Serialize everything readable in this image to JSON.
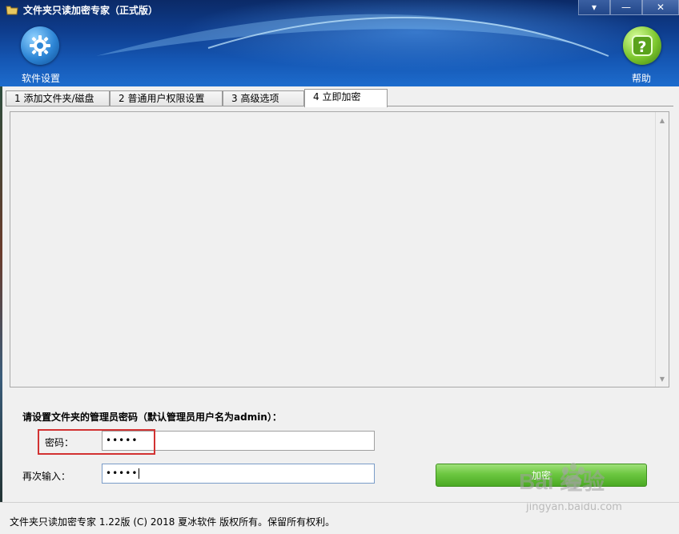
{
  "window": {
    "title": "文件夹只读加密专家（正式版）",
    "controls": {
      "menu": "▾",
      "minimize": "—",
      "close": "✕"
    }
  },
  "header": {
    "settings_label": "软件设置",
    "help_label": "帮助",
    "settings_icon": "gear-icon",
    "help_icon": "question-icon"
  },
  "tabs": [
    {
      "label": "1 添加文件夹/磁盘"
    },
    {
      "label": "2 普通用户权限设置"
    },
    {
      "label": "3 高级选项"
    },
    {
      "label": "4 立即加密"
    }
  ],
  "active_tab": 3,
  "form": {
    "prompt": "请设置文件夹的管理员密码（默认管理员用户名为admin）：",
    "password_label": "密码：",
    "password_value": "•••••",
    "confirm_label": "再次输入：",
    "confirm_value": "•••••",
    "encrypt_button": "加密"
  },
  "watermark": {
    "brand": "Bai  经验",
    "url": "jingyan.baidu.com"
  },
  "statusbar": {
    "text": "文件夹只读加密专家 1.22版 (C) 2018 夏冰软件 版权所有。保留所有权利。"
  },
  "colors": {
    "accent": "#1557b4",
    "highlight": "#d23232",
    "button": "#6cc740"
  }
}
